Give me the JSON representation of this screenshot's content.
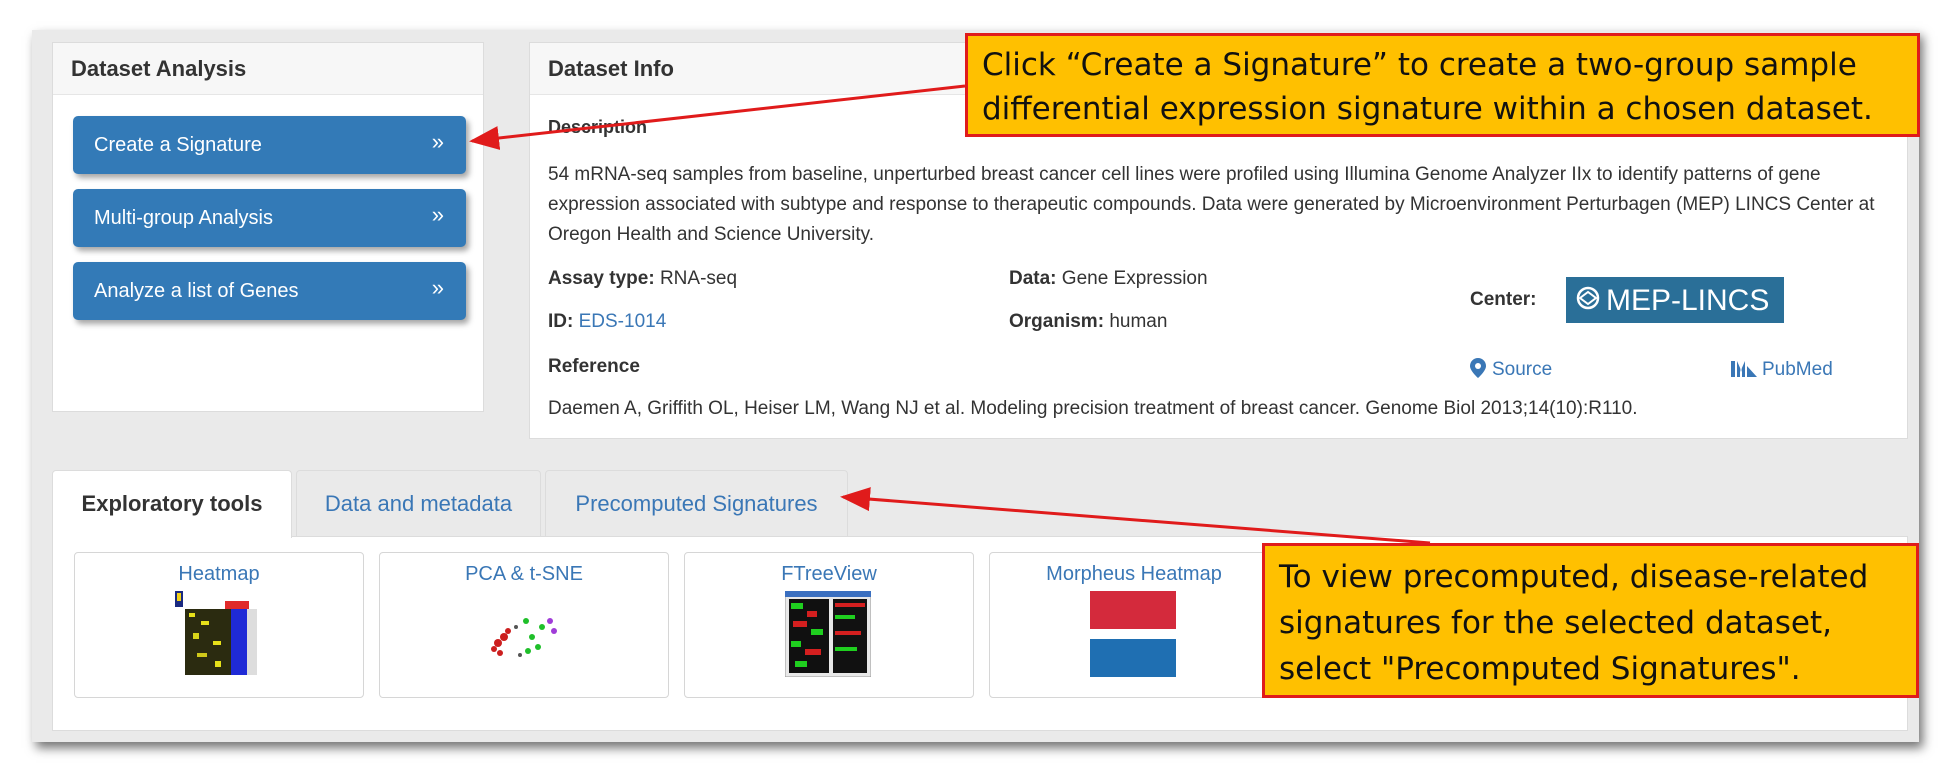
{
  "analysis_panel": {
    "title": "Dataset Analysis",
    "buttons": [
      {
        "label": "Create a Signature",
        "chevron": "»"
      },
      {
        "label": "Multi-group Analysis",
        "chevron": "»"
      },
      {
        "label": "Analyze a list of Genes",
        "chevron": "»"
      }
    ]
  },
  "info_panel": {
    "title": "Dataset Info",
    "description_label": "Description",
    "description_text": "54 mRNA-seq samples from baseline, unperturbed breast cancer cell lines were profiled using Illumina Genome Analyzer IIx to identify patterns of gene expression associated with subtype and response to therapeutic compounds. Data were generated by Microenvironment Perturbagen (MEP) LINCS Center at Oregon Health and Science University.",
    "assay_label": "Assay type:",
    "assay_value": "RNA-seq",
    "data_label": "Data:",
    "data_value": "Gene Expression",
    "id_label": "ID:",
    "id_value": "EDS-1014",
    "organism_label": "Organism:",
    "organism_value": "human",
    "center_label": "Center:",
    "center_logo_text": "MEP-LINCS",
    "reference_label": "Reference",
    "source_link": "Source",
    "pubmed_link": "PubMed",
    "reference_text": "Daemen A, Griffith OL, Heiser LM, Wang NJ et al. Modeling precision treatment of breast cancer. Genome Biol 2013;14(10):R110."
  },
  "tabs": [
    {
      "label": "Exploratory tools",
      "active": true
    },
    {
      "label": "Data and metadata",
      "active": false
    },
    {
      "label": "Precomputed Signatures",
      "active": false
    }
  ],
  "tools": [
    {
      "label": "Heatmap",
      "icon": "heatmap-thumbnail"
    },
    {
      "label": "PCA & t-SNE",
      "icon": "pca-scatter-thumbnail"
    },
    {
      "label": "FTreeView",
      "icon": "ftreeview-thumbnail"
    },
    {
      "label": "Morpheus Heatmap",
      "icon": "morpheus-thumbnail"
    }
  ],
  "callouts": {
    "top": [
      "Click “Create a Signature” to create a two-group sample",
      "differential expression signature within a chosen dataset."
    ],
    "bottom": [
      "To view precomputed, disease-related",
      "signatures for the selected dataset,",
      "select \"Precomputed Signatures\"."
    ]
  },
  "colors": {
    "primary": "#337ab7",
    "link": "#3a77b6",
    "callout_fill": "#ffc000",
    "callout_border": "#e01b1b",
    "logo_bg": "#2a6f98",
    "morpheus_red": "#d42a3c",
    "morpheus_blue": "#1f6fb2"
  }
}
